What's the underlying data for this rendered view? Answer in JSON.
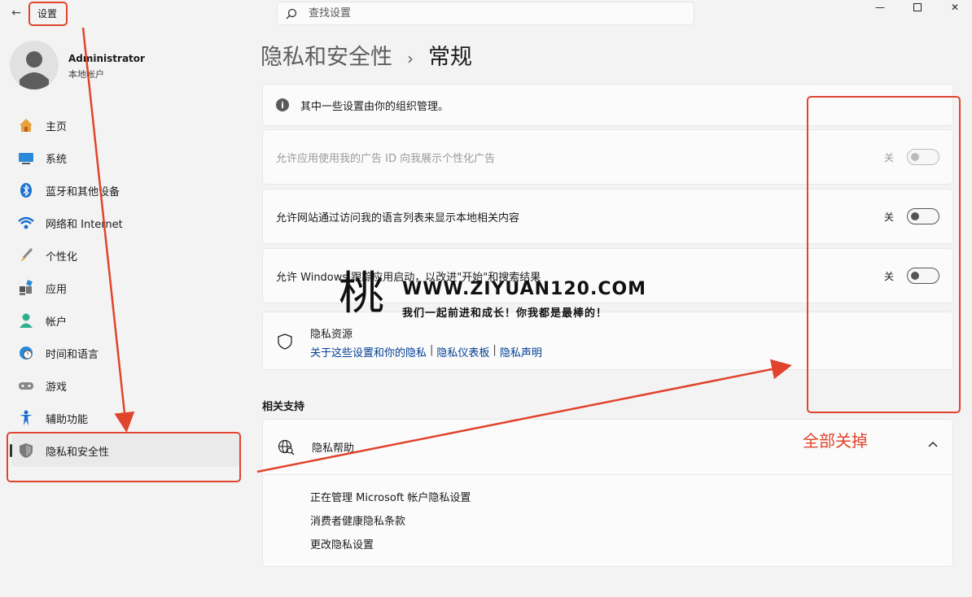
{
  "titlebar": {
    "app_title": "设置",
    "search_placeholder": "查找设置"
  },
  "user": {
    "name": "Administrator",
    "type": "本地帐户"
  },
  "sidebar": {
    "items": [
      {
        "label": "主页",
        "icon": "home-icon"
      },
      {
        "label": "系统",
        "icon": "system-icon"
      },
      {
        "label": "蓝牙和其他设备",
        "icon": "bluetooth-icon"
      },
      {
        "label": "网络和 Internet",
        "icon": "wifi-icon"
      },
      {
        "label": "个性化",
        "icon": "brush-icon"
      },
      {
        "label": "应用",
        "icon": "apps-icon"
      },
      {
        "label": "帐户",
        "icon": "account-icon"
      },
      {
        "label": "时间和语言",
        "icon": "clock-globe-icon"
      },
      {
        "label": "游戏",
        "icon": "gamepad-icon"
      },
      {
        "label": "辅助功能",
        "icon": "accessibility-icon"
      },
      {
        "label": "隐私和安全性",
        "icon": "shield-icon",
        "active": true
      }
    ]
  },
  "main": {
    "breadcrumb_parent": "隐私和安全性",
    "breadcrumb_sep": "›",
    "breadcrumb_current": "常规",
    "info": "其中一些设置由你的组织管理。",
    "toggles": [
      {
        "label": "允许应用使用我的广告 ID 向我展示个性化广告",
        "state": "关",
        "disabled": true
      },
      {
        "label": "允许网站通过访问我的语言列表来显示本地相关内容",
        "state": "关",
        "disabled": false
      },
      {
        "label": "允许 Windows 跟踪应用启动，以改进\"开始\"和搜索结果",
        "state": "关",
        "disabled": false
      }
    ],
    "resources": {
      "title": "隐私资源",
      "links": [
        "关于这些设置和你的隐私",
        "隐私仪表板",
        "隐私声明"
      ],
      "separator": "|"
    },
    "related_title": "相关支持",
    "help": {
      "title": "隐私帮助",
      "links": [
        "正在管理 Microsoft 帐户隐私设置",
        "消费者健康隐私条款",
        "更改隐私设置"
      ]
    }
  },
  "annotation": {
    "text": "全部关掉",
    "color": "#e0442c"
  },
  "watermark": {
    "logo": "桃",
    "url": "WWW.ZIYUAN120.COM",
    "slogan": "我们一起前进和成长！你我都是最棒的！"
  }
}
